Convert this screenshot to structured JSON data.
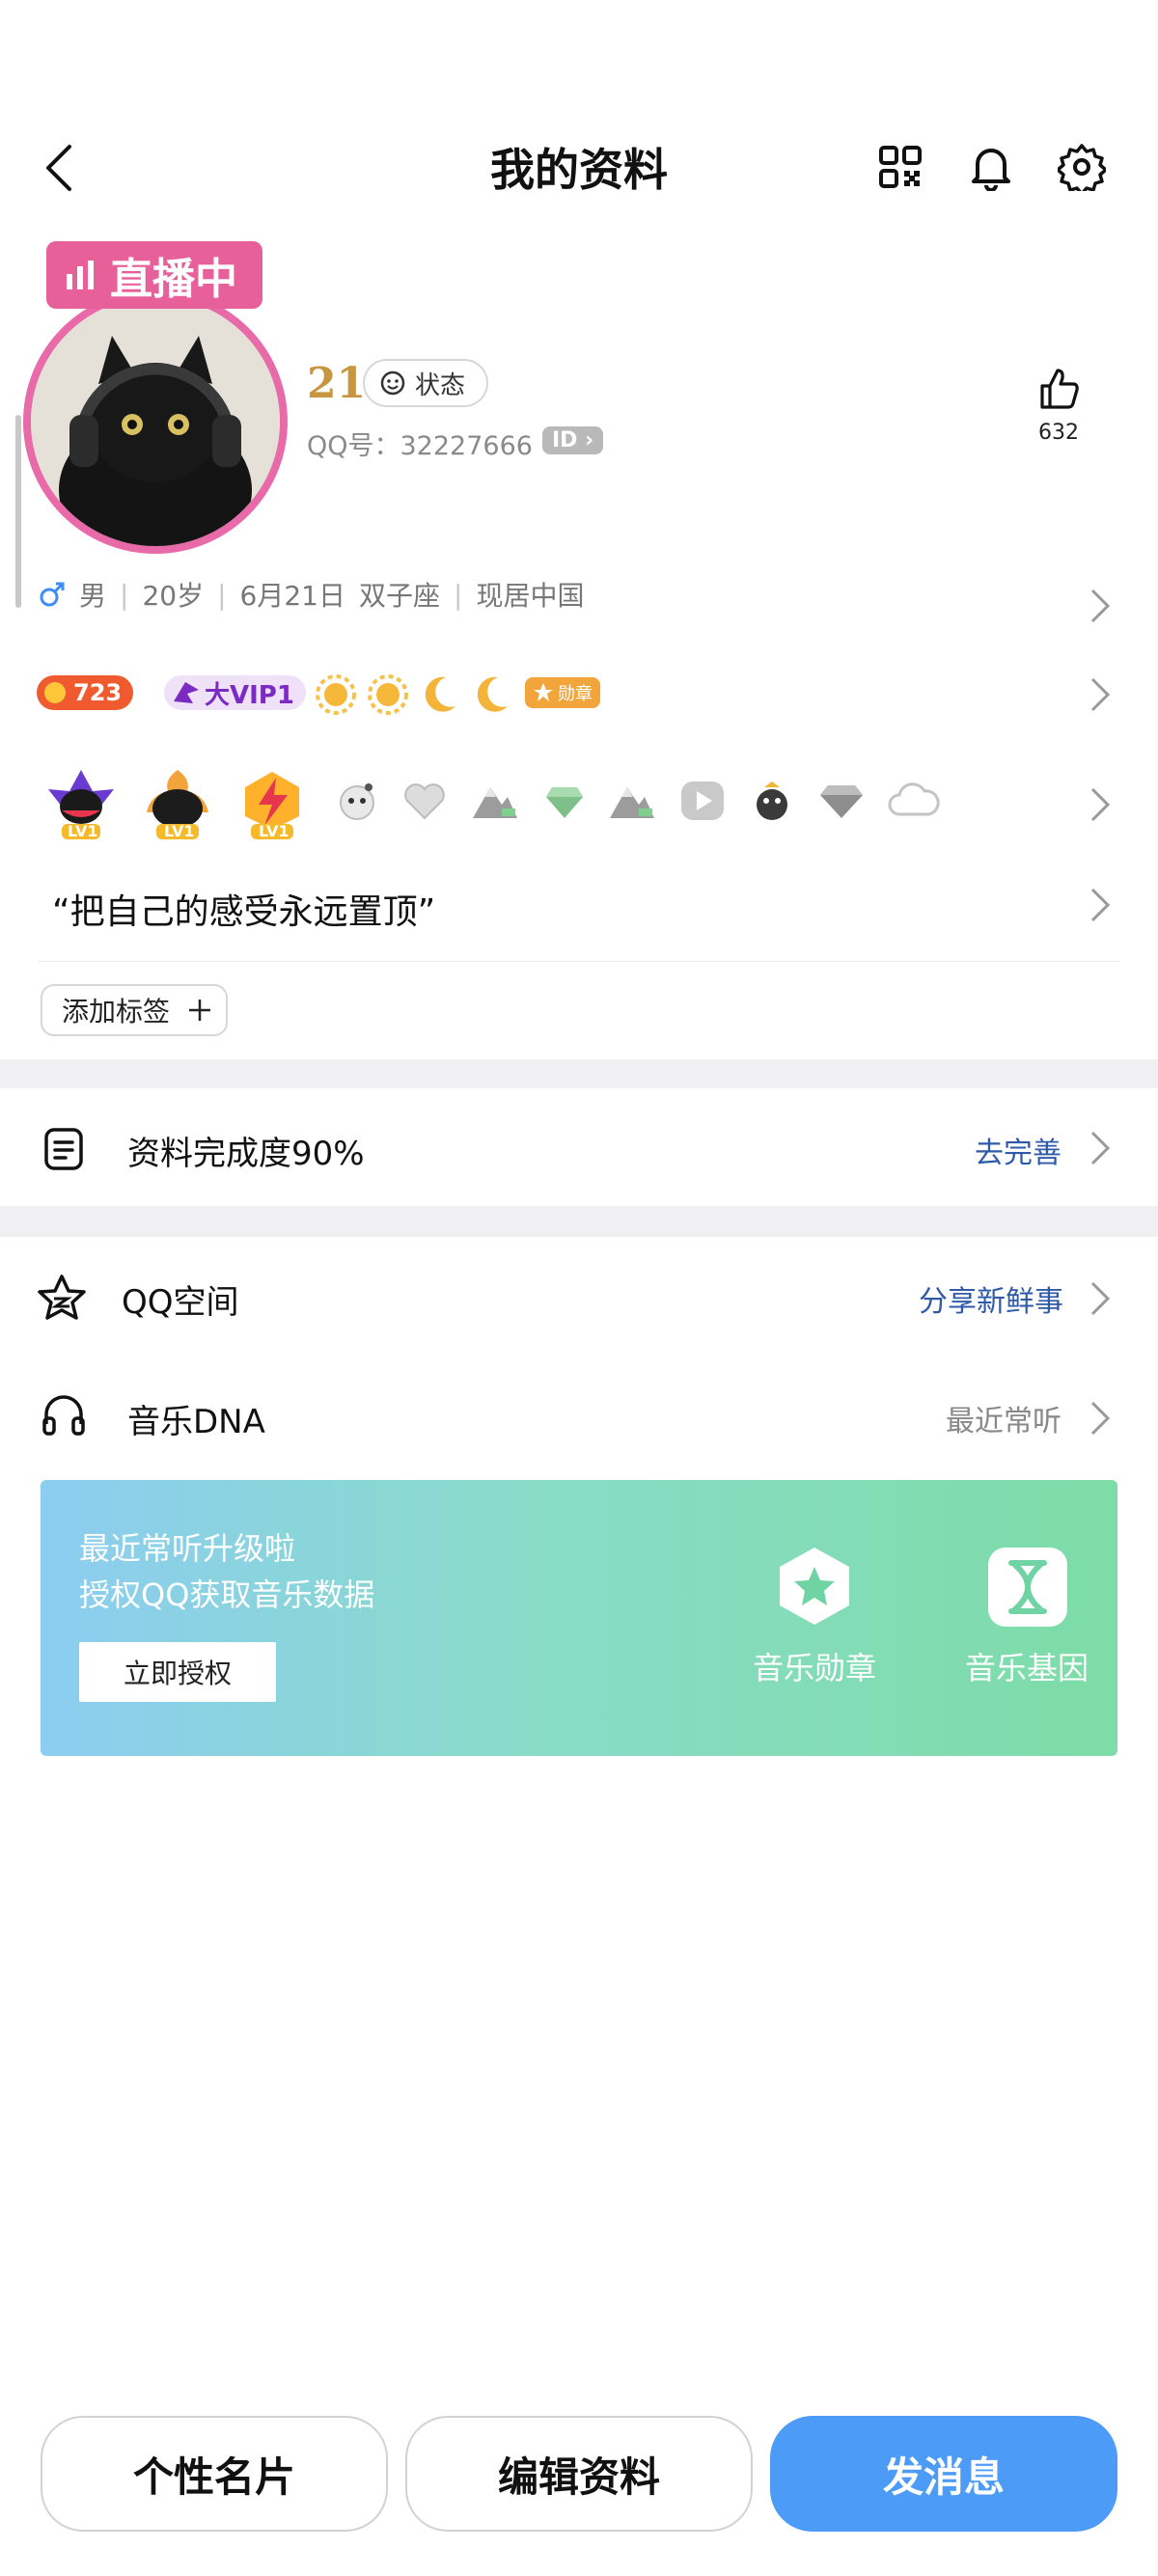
{
  "header": {
    "title": "我的资料"
  },
  "profile": {
    "live_badge": "直播中",
    "nickname": "21",
    "status_label": "状态",
    "qq_number": "QQ号：32227666",
    "id_badge": "ID",
    "like_count": "632"
  },
  "info_row": [
    "男",
    "20岁",
    "6月21日",
    "双子座",
    "现居中国"
  ],
  "badges": {
    "level": "723",
    "vip": "大VIP1",
    "medal": "勋章"
  },
  "icon_row": {
    "lv1": "LV1",
    "icons": [
      "qq-lv1-icon",
      "qq-lv1-black-icon",
      "qq-lv1-flash-icon",
      "emoji-face-icon",
      "heart-icon",
      "mountain-icon",
      "diamond-green-icon",
      "mountain-green-icon",
      "play-icon",
      "penguin-icon",
      "diamond-icon",
      "cloud-icon"
    ]
  },
  "signature": "“把自己的感受永远置顶”",
  "add_tag_label": "添加标签",
  "completion": {
    "label": "资料完成度90%",
    "action": "去完善"
  },
  "qzone": {
    "label": "QQ空间",
    "action": "分享新鲜事"
  },
  "music_dna": {
    "label": "音乐DNA",
    "action": "最近常听"
  },
  "music_card": {
    "line1": "最近常听升级啦",
    "line2": "授权QQ获取音乐数据",
    "button": "立即授权",
    "item1": "音乐勋章",
    "item2": "音乐基因"
  },
  "bottom": {
    "card": "个性名片",
    "edit": "编辑资料",
    "message": "发消息"
  },
  "colors": {
    "accent_blue": "#4b9bf7",
    "live_pink": "#e8609a",
    "link_blue": "#2e5aa8"
  }
}
